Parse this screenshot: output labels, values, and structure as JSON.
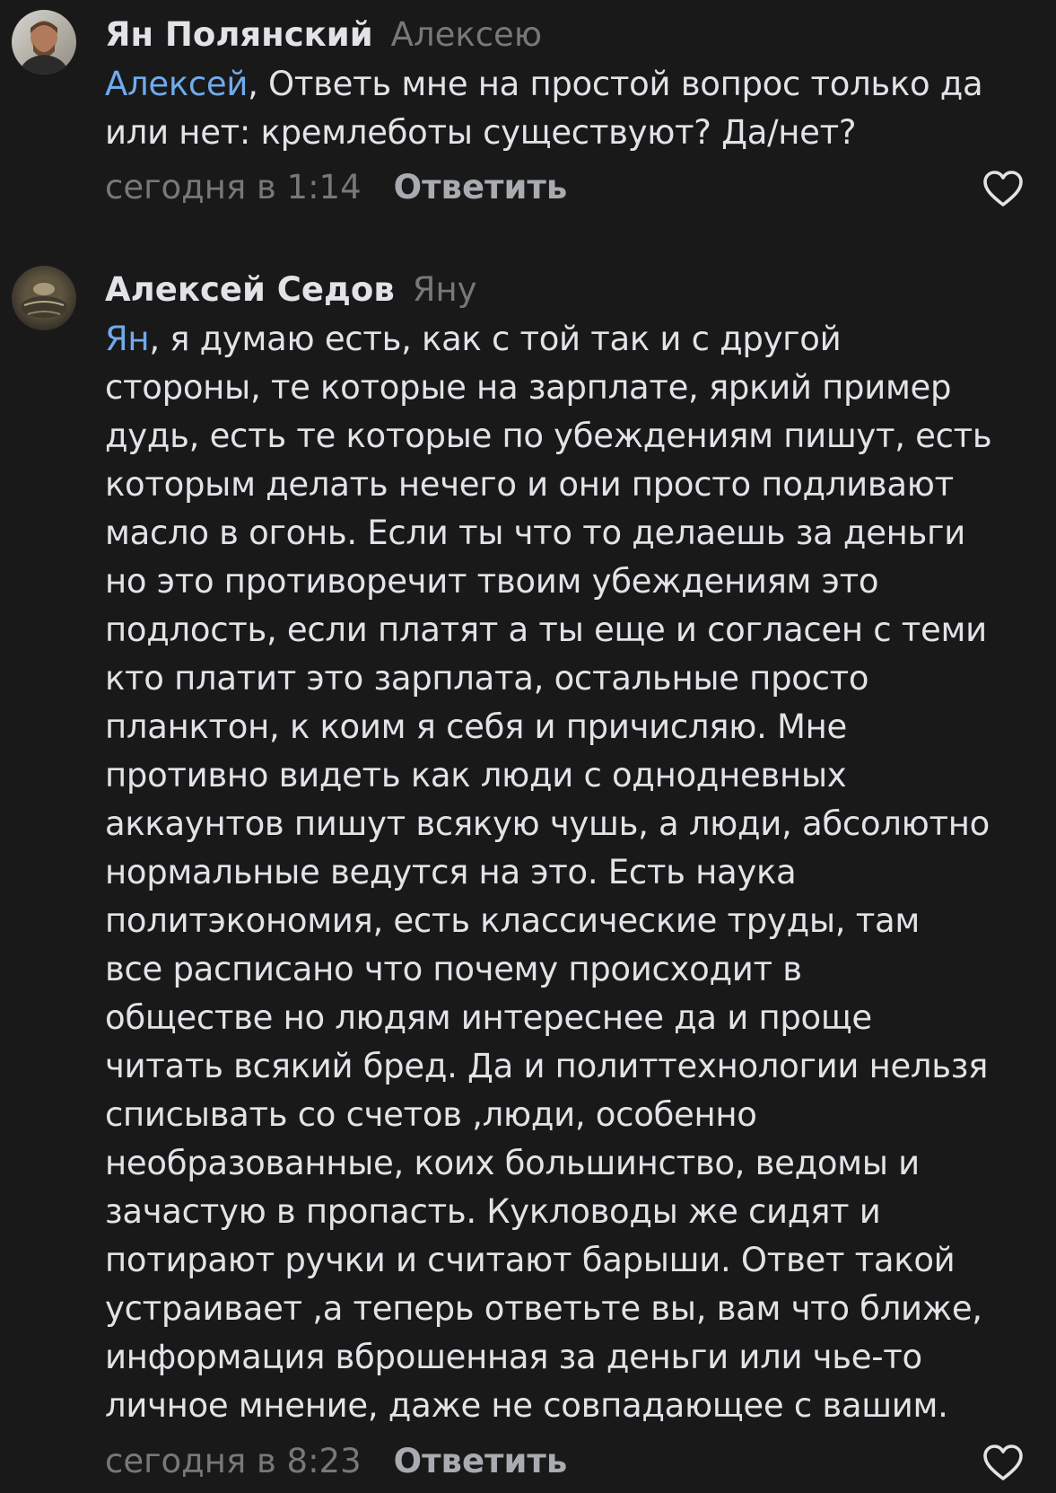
{
  "comments": [
    {
      "author": "Ян Полянский",
      "reply_to": "Алексею",
      "mention": "Алексей",
      "text": ", Ответь мне на простой вопрос только да\nили нет: кремлеботы существуют? Да/нет?",
      "time": "сегодня в 1:14",
      "reply_label": "Ответить"
    },
    {
      "author": "Алексей Седов",
      "reply_to": "Яну",
      "mention": "Ян",
      "text": ", я думаю есть, как с той так и с другой\nстороны, те которые на зарплате, яркий пример\nдудь, есть те которые по убеждениям пишут, есть\nкоторым делать нечего и они просто подливают\nмасло в огонь. Если ты что то делаешь за деньги\nно это противоречит твоим убеждениям это\nподлость, если платят а ты еще и согласен с теми\nкто платит это зарплата, остальные просто\nпланктон, к коим я себя и причисляю. Мне\nпротивно видеть как люди с однодневных\nаккаунтов пишут всякую чушь, а люди, абсолютно\nнормальные ведутся на это. Есть наука\nполитэкономия, есть классические труды, там\nвсе расписано что почему происходит в\nобществе но людям интереснее да и проще\nчитать всякий бред. Да и политтехнологии нельзя\nсписывать со счетов ,люди, особенно\nнеобразованные, коих большинство, ведомы и\nзачастую в пропасть. Кукловоды же сидят и\nпотирают ручки и считают барыши. Ответ такой\nустраивает ,а теперь ответьте вы, вам что ближе,\nинформация вброшенная за деньги или чье-то\nличное мнение, даже не совпадающее с вашим.",
      "time": "сегодня в 8:23",
      "reply_label": "Ответить"
    }
  ],
  "colors": {
    "background": "#19191a",
    "text": "#e1e3e6",
    "secondary": "#76787a",
    "mention": "#71aaeb",
    "action": "#a8abaf"
  },
  "icons": {
    "like": "heart-outline-icon"
  }
}
